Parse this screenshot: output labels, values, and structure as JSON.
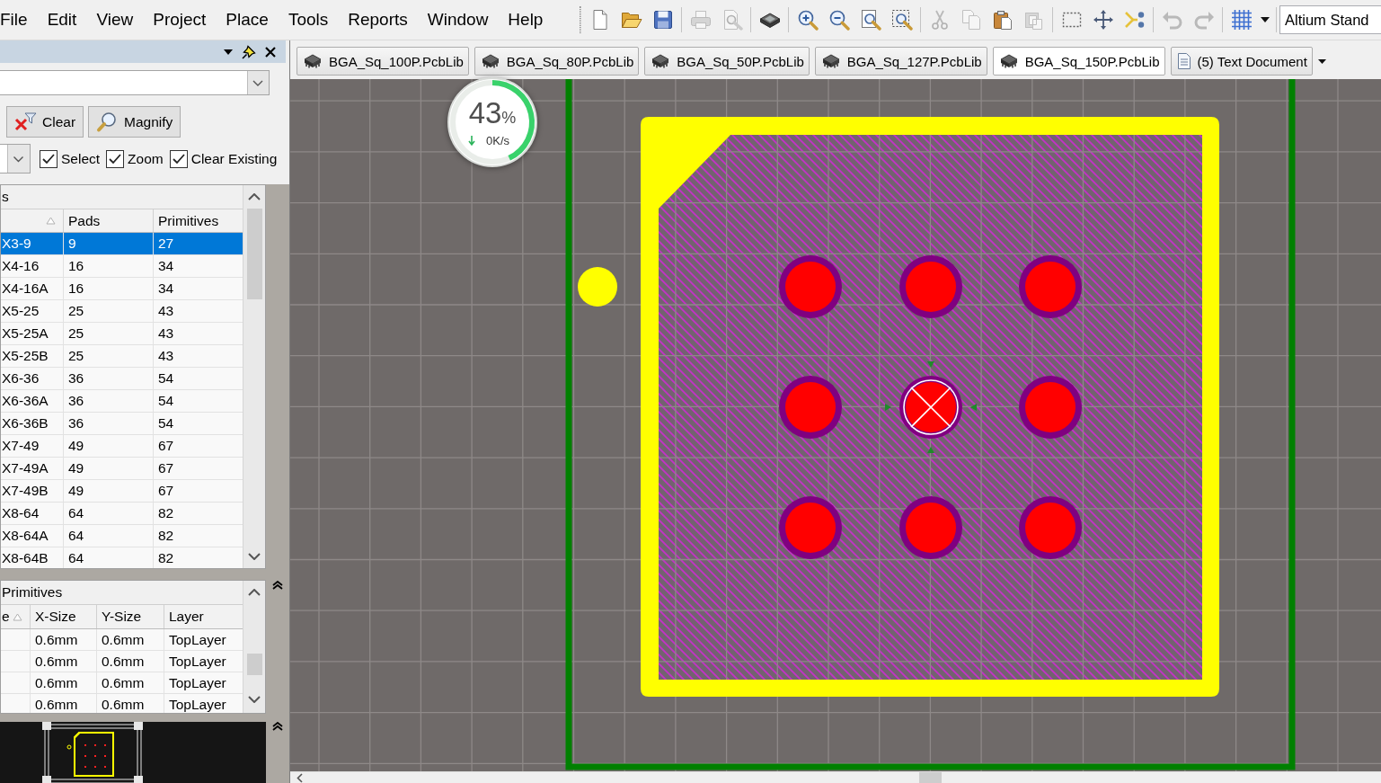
{
  "menu": [
    "File",
    "Edit",
    "View",
    "Project",
    "Place",
    "Tools",
    "Reports",
    "Window",
    "Help"
  ],
  "toolbar": [
    [
      {
        "kind": "new",
        "disabled": false
      },
      {
        "kind": "open",
        "disabled": false
      },
      {
        "kind": "save",
        "disabled": false
      }
    ],
    [
      {
        "kind": "print",
        "disabled": true
      },
      {
        "kind": "preview",
        "disabled": true
      }
    ],
    [
      {
        "kind": "layers",
        "disabled": false
      }
    ],
    [
      {
        "kind": "zoom_in",
        "disabled": false
      },
      {
        "kind": "zoom_out",
        "disabled": false
      },
      {
        "kind": "zoom_fit",
        "disabled": false
      },
      {
        "kind": "zoom_area",
        "disabled": false
      }
    ],
    [
      {
        "kind": "cut",
        "disabled": true
      },
      {
        "kind": "copy",
        "disabled": true
      },
      {
        "kind": "paste",
        "disabled": false
      },
      {
        "kind": "paste_array",
        "disabled": true
      }
    ],
    [
      {
        "kind": "select_area",
        "disabled": false
      },
      {
        "kind": "move",
        "disabled": false
      },
      {
        "kind": "cross_select",
        "disabled": false
      }
    ],
    [
      {
        "kind": "undo",
        "disabled": true
      },
      {
        "kind": "redo",
        "disabled": true
      }
    ],
    [
      {
        "kind": "grid",
        "disabled": false
      },
      {
        "kind": "dropdown",
        "disabled": false
      }
    ]
  ],
  "configuration_dropdown": {
    "value": "Altium Stand"
  },
  "library_panel": {
    "buttons": [
      {
        "kind": "clear",
        "label": "Clear"
      },
      {
        "kind": "magnify",
        "label": "Magnify"
      }
    ],
    "options": [
      {
        "label": "Select",
        "checked": true
      },
      {
        "label": "Zoom",
        "checked": true
      },
      {
        "label": "Clear Existing",
        "checked": true
      }
    ],
    "components_table": {
      "title": "s",
      "columns": [
        {
          "sort_ascending": true
        },
        {
          "label": "Pads",
          "sort_ascending": false
        },
        {
          "label": "Primitives",
          "sort_ascending": false
        }
      ],
      "rows": [
        {
          "column_1": "X3-9",
          "pads": "9",
          "primitives": "27",
          "selected": true
        },
        {
          "column_1": "X4-16",
          "pads": "16",
          "primitives": "34",
          "selected": false
        },
        {
          "column_1": "X4-16A",
          "pads": "16",
          "primitives": "34",
          "selected": false
        },
        {
          "column_1": "X5-25",
          "pads": "25",
          "primitives": "43",
          "selected": false
        },
        {
          "column_1": "X5-25A",
          "pads": "25",
          "primitives": "43",
          "selected": false
        },
        {
          "column_1": "X5-25B",
          "pads": "25",
          "primitives": "43",
          "selected": false
        },
        {
          "column_1": "X6-36",
          "pads": "36",
          "primitives": "54",
          "selected": false
        },
        {
          "column_1": "X6-36A",
          "pads": "36",
          "primitives": "54",
          "selected": false
        },
        {
          "column_1": "X6-36B",
          "pads": "36",
          "primitives": "54",
          "selected": false
        },
        {
          "column_1": "X7-49",
          "pads": "49",
          "primitives": "67",
          "selected": false
        },
        {
          "column_1": "X7-49A",
          "pads": "49",
          "primitives": "67",
          "selected": false
        },
        {
          "column_1": "X7-49B",
          "pads": "49",
          "primitives": "67",
          "selected": false
        },
        {
          "column_1": "X8-64",
          "pads": "64",
          "primitives": "82",
          "selected": false
        },
        {
          "column_1": "X8-64A",
          "pads": "64",
          "primitives": "82",
          "selected": false
        },
        {
          "column_1": "X8-64B",
          "pads": "64",
          "primitives": "82",
          "selected": false
        }
      ]
    },
    "primitives_table": {
      "title": "Primitives",
      "columns": [
        {
          "label": "e",
          "sort_ascending": true
        },
        {
          "label": "X-Size",
          "sort_ascending": false
        },
        {
          "label": "Y-Size",
          "sort_ascending": false
        },
        {
          "label": "Layer",
          "sort_ascending": false
        }
      ],
      "rows": [
        {
          "x_size": "0.6mm",
          "y_size": "0.6mm",
          "layer": "TopLayer",
          "selected": false
        },
        {
          "x_size": "0.6mm",
          "y_size": "0.6mm",
          "layer": "TopLayer",
          "selected": false
        },
        {
          "x_size": "0.6mm",
          "y_size": "0.6mm",
          "layer": "TopLayer",
          "selected": false
        },
        {
          "x_size": "0.6mm",
          "y_size": "0.6mm",
          "layer": "TopLayer",
          "selected": false
        }
      ]
    }
  },
  "document_tabs": [
    {
      "kind": "pcblib",
      "label": "BGA_Sq_100P.PcbLib",
      "selected": false
    },
    {
      "kind": "pcblib",
      "label": "BGA_Sq_80P.PcbLib",
      "selected": false
    },
    {
      "kind": "pcblib",
      "label": "BGA_Sq_50P.PcbLib",
      "selected": false
    },
    {
      "kind": "pcblib",
      "label": "BGA_Sq_127P.PcbLib",
      "selected": false
    },
    {
      "kind": "pcblib",
      "label": "BGA_Sq_150P.PcbLib",
      "selected": true
    },
    {
      "kind": "text",
      "label": "(5) Text Document",
      "selected": false
    }
  ],
  "speed_monitor": {
    "percent": "43",
    "unit": "%",
    "rate": "0K/s",
    "level": 0.43
  }
}
